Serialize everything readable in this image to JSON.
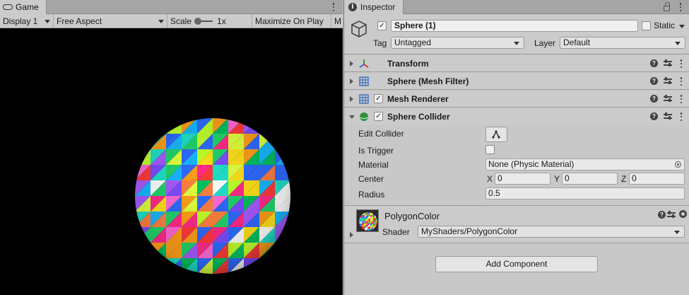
{
  "game": {
    "tab_label": "Game",
    "display": "Display 1",
    "aspect": "Free Aspect",
    "scale_label": "Scale",
    "scale_value": "1x",
    "maximize": "Maximize On Play",
    "cut_item": "M"
  },
  "inspector": {
    "tab_label": "Inspector",
    "object_name": "Sphere (1)",
    "static_label": "Static",
    "tag_label": "Tag",
    "tag_value": "Untagged",
    "layer_label": "Layer",
    "layer_value": "Default",
    "components": [
      {
        "title": "Transform"
      },
      {
        "title": "Sphere (Mesh Filter)"
      },
      {
        "title": "Mesh Renderer"
      },
      {
        "title": "Sphere Collider"
      }
    ],
    "collider": {
      "edit_label": "Edit Collider",
      "trigger_label": "Is Trigger",
      "material_label": "Material",
      "material_value": "None (Physic Material)",
      "center_label": "Center",
      "x_label": "X",
      "x_value": "0",
      "y_label": "Y",
      "y_value": "0",
      "z_label": "Z",
      "z_value": "0",
      "radius_label": "Radius",
      "radius_value": "0.5"
    },
    "material": {
      "name": "PolygonColor",
      "shader_label": "Shader",
      "shader_value": "MyShaders/PolygonColor"
    },
    "add_component": "Add Component"
  },
  "colors": {
    "editor_bg": "#c8c8c8",
    "viewport_bg": "#000000",
    "transform_red": "#d0403a",
    "transform_green": "#2e9a3c",
    "transform_blue": "#3a6bc8",
    "collider_green": "#2f8f3e",
    "mesh_blue": "#3f6fbf"
  }
}
